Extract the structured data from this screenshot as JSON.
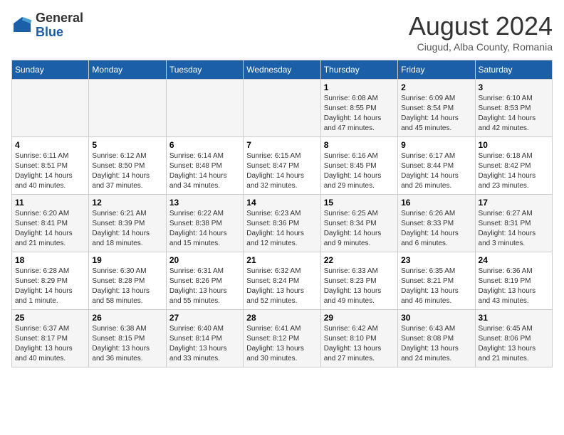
{
  "header": {
    "logo_general": "General",
    "logo_blue": "Blue",
    "month_year": "August 2024",
    "location": "Ciugud, Alba County, Romania"
  },
  "days_of_week": [
    "Sunday",
    "Monday",
    "Tuesday",
    "Wednesday",
    "Thursday",
    "Friday",
    "Saturday"
  ],
  "weeks": [
    [
      {
        "day": "",
        "info": ""
      },
      {
        "day": "",
        "info": ""
      },
      {
        "day": "",
        "info": ""
      },
      {
        "day": "",
        "info": ""
      },
      {
        "day": "1",
        "info": "Sunrise: 6:08 AM\nSunset: 8:55 PM\nDaylight: 14 hours\nand 47 minutes."
      },
      {
        "day": "2",
        "info": "Sunrise: 6:09 AM\nSunset: 8:54 PM\nDaylight: 14 hours\nand 45 minutes."
      },
      {
        "day": "3",
        "info": "Sunrise: 6:10 AM\nSunset: 8:53 PM\nDaylight: 14 hours\nand 42 minutes."
      }
    ],
    [
      {
        "day": "4",
        "info": "Sunrise: 6:11 AM\nSunset: 8:51 PM\nDaylight: 14 hours\nand 40 minutes."
      },
      {
        "day": "5",
        "info": "Sunrise: 6:12 AM\nSunset: 8:50 PM\nDaylight: 14 hours\nand 37 minutes."
      },
      {
        "day": "6",
        "info": "Sunrise: 6:14 AM\nSunset: 8:48 PM\nDaylight: 14 hours\nand 34 minutes."
      },
      {
        "day": "7",
        "info": "Sunrise: 6:15 AM\nSunset: 8:47 PM\nDaylight: 14 hours\nand 32 minutes."
      },
      {
        "day": "8",
        "info": "Sunrise: 6:16 AM\nSunset: 8:45 PM\nDaylight: 14 hours\nand 29 minutes."
      },
      {
        "day": "9",
        "info": "Sunrise: 6:17 AM\nSunset: 8:44 PM\nDaylight: 14 hours\nand 26 minutes."
      },
      {
        "day": "10",
        "info": "Sunrise: 6:18 AM\nSunset: 8:42 PM\nDaylight: 14 hours\nand 23 minutes."
      }
    ],
    [
      {
        "day": "11",
        "info": "Sunrise: 6:20 AM\nSunset: 8:41 PM\nDaylight: 14 hours\nand 21 minutes."
      },
      {
        "day": "12",
        "info": "Sunrise: 6:21 AM\nSunset: 8:39 PM\nDaylight: 14 hours\nand 18 minutes."
      },
      {
        "day": "13",
        "info": "Sunrise: 6:22 AM\nSunset: 8:38 PM\nDaylight: 14 hours\nand 15 minutes."
      },
      {
        "day": "14",
        "info": "Sunrise: 6:23 AM\nSunset: 8:36 PM\nDaylight: 14 hours\nand 12 minutes."
      },
      {
        "day": "15",
        "info": "Sunrise: 6:25 AM\nSunset: 8:34 PM\nDaylight: 14 hours\nand 9 minutes."
      },
      {
        "day": "16",
        "info": "Sunrise: 6:26 AM\nSunset: 8:33 PM\nDaylight: 14 hours\nand 6 minutes."
      },
      {
        "day": "17",
        "info": "Sunrise: 6:27 AM\nSunset: 8:31 PM\nDaylight: 14 hours\nand 3 minutes."
      }
    ],
    [
      {
        "day": "18",
        "info": "Sunrise: 6:28 AM\nSunset: 8:29 PM\nDaylight: 14 hours\nand 1 minute."
      },
      {
        "day": "19",
        "info": "Sunrise: 6:30 AM\nSunset: 8:28 PM\nDaylight: 13 hours\nand 58 minutes."
      },
      {
        "day": "20",
        "info": "Sunrise: 6:31 AM\nSunset: 8:26 PM\nDaylight: 13 hours\nand 55 minutes."
      },
      {
        "day": "21",
        "info": "Sunrise: 6:32 AM\nSunset: 8:24 PM\nDaylight: 13 hours\nand 52 minutes."
      },
      {
        "day": "22",
        "info": "Sunrise: 6:33 AM\nSunset: 8:23 PM\nDaylight: 13 hours\nand 49 minutes."
      },
      {
        "day": "23",
        "info": "Sunrise: 6:35 AM\nSunset: 8:21 PM\nDaylight: 13 hours\nand 46 minutes."
      },
      {
        "day": "24",
        "info": "Sunrise: 6:36 AM\nSunset: 8:19 PM\nDaylight: 13 hours\nand 43 minutes."
      }
    ],
    [
      {
        "day": "25",
        "info": "Sunrise: 6:37 AM\nSunset: 8:17 PM\nDaylight: 13 hours\nand 40 minutes."
      },
      {
        "day": "26",
        "info": "Sunrise: 6:38 AM\nSunset: 8:15 PM\nDaylight: 13 hours\nand 36 minutes."
      },
      {
        "day": "27",
        "info": "Sunrise: 6:40 AM\nSunset: 8:14 PM\nDaylight: 13 hours\nand 33 minutes."
      },
      {
        "day": "28",
        "info": "Sunrise: 6:41 AM\nSunset: 8:12 PM\nDaylight: 13 hours\nand 30 minutes."
      },
      {
        "day": "29",
        "info": "Sunrise: 6:42 AM\nSunset: 8:10 PM\nDaylight: 13 hours\nand 27 minutes."
      },
      {
        "day": "30",
        "info": "Sunrise: 6:43 AM\nSunset: 8:08 PM\nDaylight: 13 hours\nand 24 minutes."
      },
      {
        "day": "31",
        "info": "Sunrise: 6:45 AM\nSunset: 8:06 PM\nDaylight: 13 hours\nand 21 minutes."
      }
    ]
  ]
}
